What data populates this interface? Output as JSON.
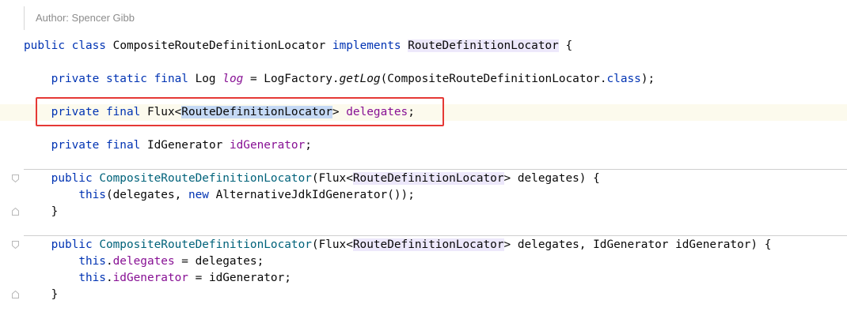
{
  "author_hint": "Author: Spencer Gibb",
  "code": {
    "class_decl": {
      "kw_public": "public",
      "kw_class": "class",
      "name": "CompositeRouteDefinitionLocator",
      "kw_implements": "implements",
      "interface": "RouteDefinitionLocator",
      "brace": " {"
    },
    "log_line": {
      "mods": "private static final",
      "type": "Log",
      "field": "log",
      "eq": "=",
      "factory": "LogFactory.",
      "call": "getLog",
      "arg_open": "(CompositeRouteDefinitionLocator.",
      "kw_class": "class",
      "end": ");"
    },
    "delegates_line": {
      "mods": "private final",
      "type_open": "Flux<",
      "generic": "RouteDefinitionLocator",
      "type_close": ">",
      "field": "delegates",
      "end": ";"
    },
    "idgen_line": {
      "mods": "private final",
      "type": "IdGenerator",
      "field": "idGenerator",
      "end": ";"
    },
    "ctor1": {
      "kw_public": "public",
      "name": "CompositeRouteDefinitionLocator",
      "param_open": "(Flux<",
      "generic": "RouteDefinitionLocator",
      "param_close": "> delegates) {",
      "body_this": "this",
      "body_args": "(delegates, ",
      "body_new": "new",
      "body_rest": " AlternativeJdkIdGenerator());",
      "close": "}"
    },
    "ctor2": {
      "kw_public": "public",
      "name": "CompositeRouteDefinitionLocator",
      "param_open": "(Flux<",
      "generic": "RouteDefinitionLocator",
      "param_close": "> delegates, IdGenerator idGenerator) {",
      "this1": "this",
      "field1": "delegates",
      "assign1": " = delegates;",
      "this2": "this",
      "field2": "idGenerator",
      "assign2": " = idGenerator;",
      "close": "}"
    }
  },
  "colors": {
    "keyword": "#0033b3",
    "field": "#871094",
    "method": "#00627a",
    "highlight_box": "#e53935",
    "selection": "#c5d9f5"
  }
}
